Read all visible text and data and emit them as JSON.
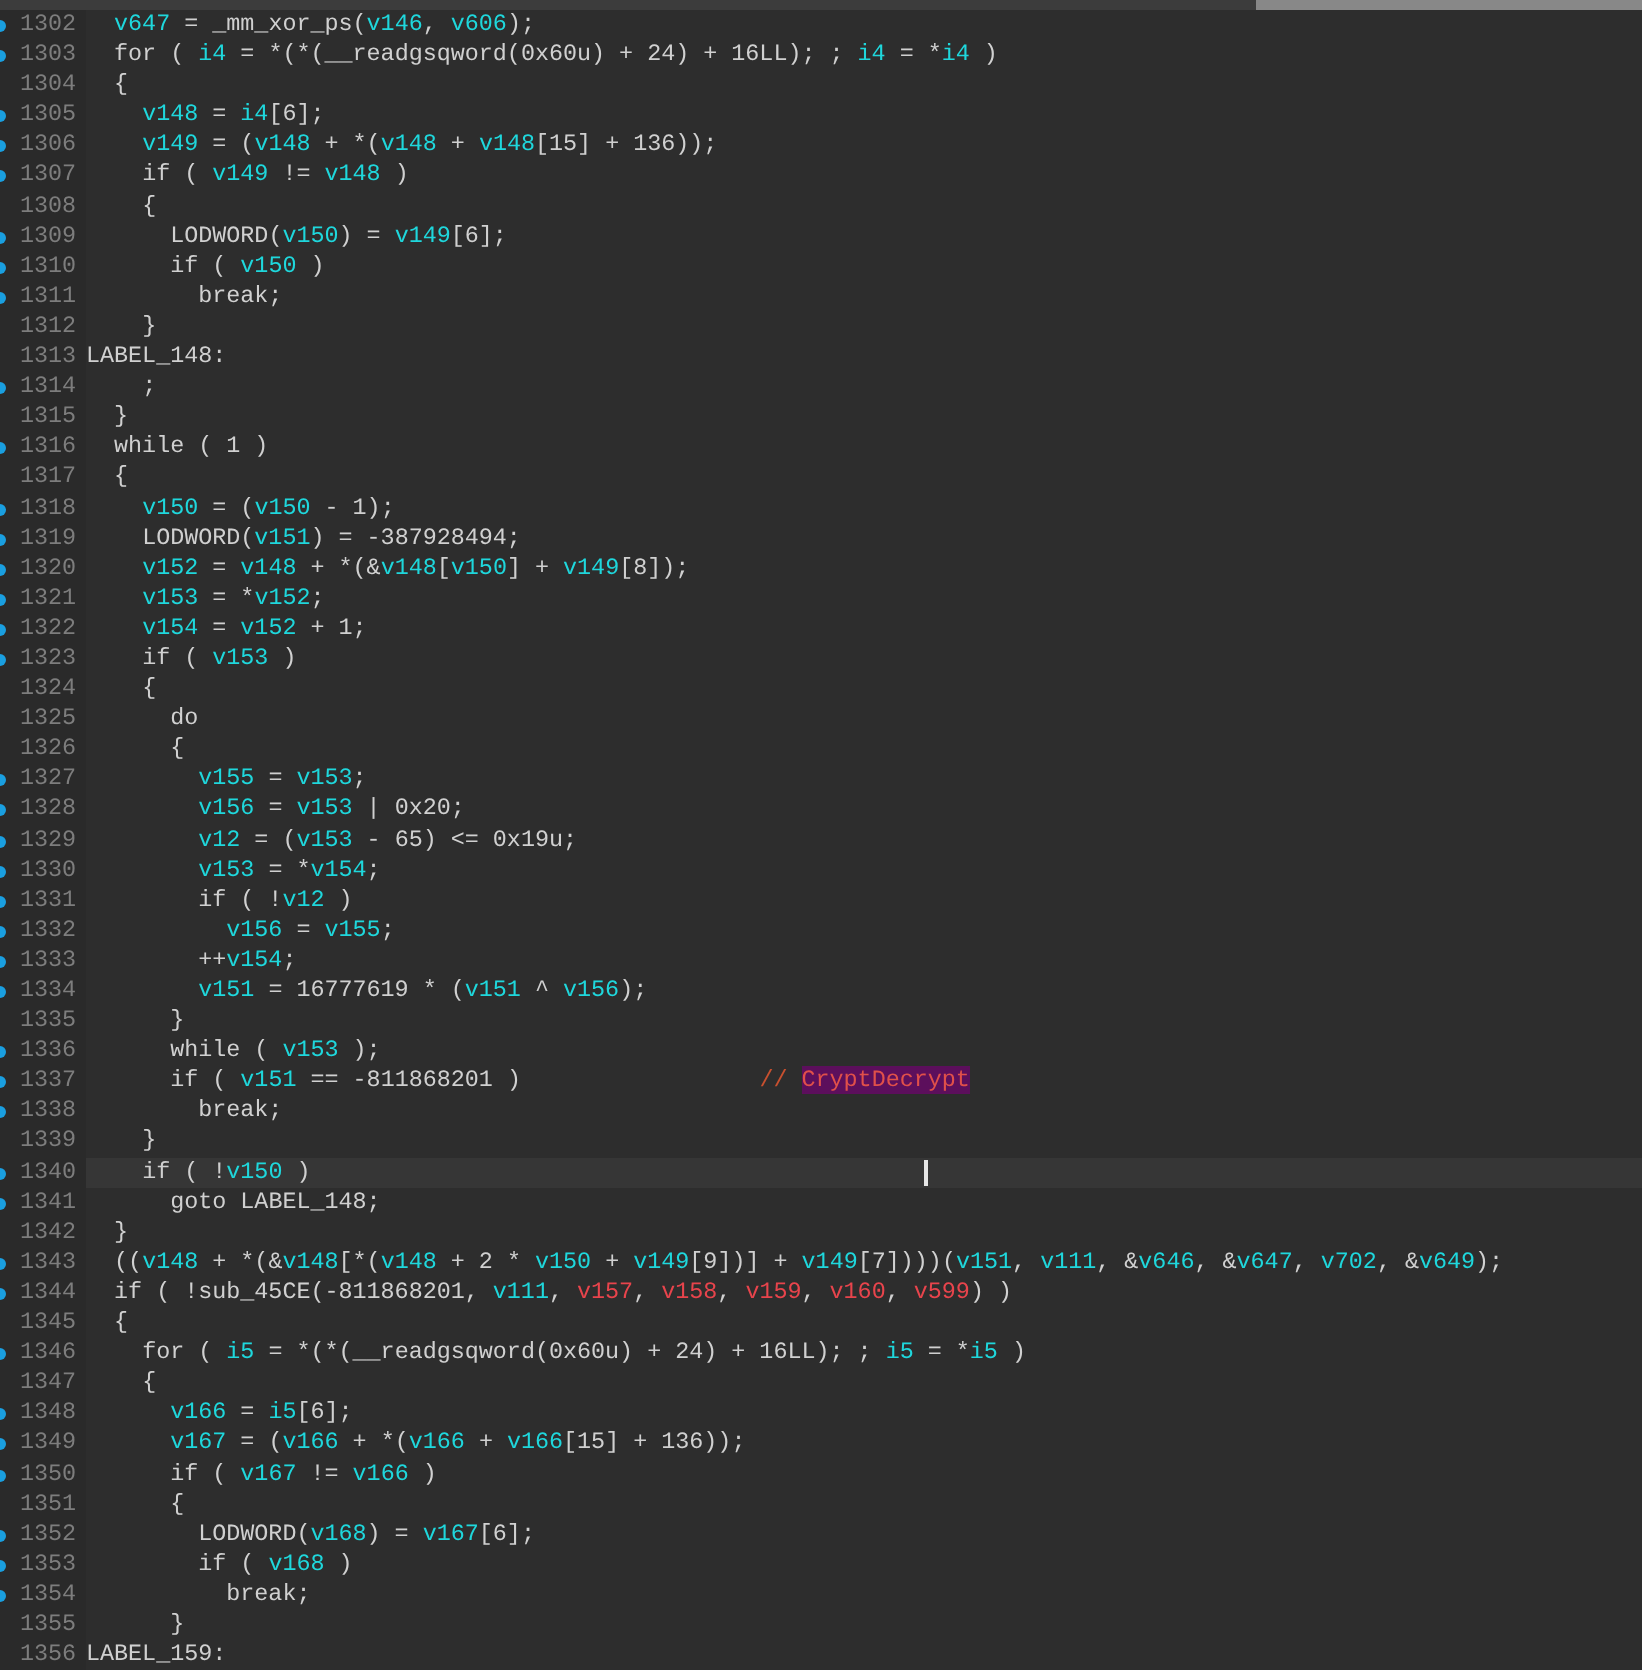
{
  "editor": {
    "lines": [
      {
        "number": "1302",
        "breakpoint": true,
        "selected": false,
        "code": [
          {
            "text": "  v647",
            "kind": "var"
          },
          {
            "text": " = _mm_xor_ps(",
            "kind": "plain"
          },
          {
            "text": "v146",
            "kind": "var"
          },
          {
            "text": ", ",
            "kind": "plain"
          },
          {
            "text": "v606",
            "kind": "var"
          },
          {
            "text": ");",
            "kind": "plain"
          }
        ]
      },
      {
        "number": "1303",
        "breakpoint": true,
        "selected": false,
        "code": [
          {
            "text": "  for ( ",
            "kind": "plain"
          },
          {
            "text": "i4",
            "kind": "var"
          },
          {
            "text": " = *(*(__readgsqword(0x60u) + 24) + 16LL); ; ",
            "kind": "plain"
          },
          {
            "text": "i4",
            "kind": "var"
          },
          {
            "text": " = *",
            "kind": "plain"
          },
          {
            "text": "i4",
            "kind": "var"
          },
          {
            "text": " )",
            "kind": "plain"
          }
        ]
      },
      {
        "number": "1304",
        "breakpoint": false,
        "selected": false,
        "code": [
          {
            "text": "  {",
            "kind": "plain"
          }
        ]
      },
      {
        "number": "1305",
        "breakpoint": true,
        "selected": false,
        "code": [
          {
            "text": "    v148",
            "kind": "var"
          },
          {
            "text": " = ",
            "kind": "plain"
          },
          {
            "text": "i4",
            "kind": "var"
          },
          {
            "text": "[6];",
            "kind": "plain"
          }
        ]
      },
      {
        "number": "1306",
        "breakpoint": true,
        "selected": false,
        "code": [
          {
            "text": "    v149",
            "kind": "var"
          },
          {
            "text": " = (",
            "kind": "plain"
          },
          {
            "text": "v148",
            "kind": "var"
          },
          {
            "text": " + *(",
            "kind": "plain"
          },
          {
            "text": "v148",
            "kind": "var"
          },
          {
            "text": " + ",
            "kind": "plain"
          },
          {
            "text": "v148",
            "kind": "var"
          },
          {
            "text": "[15] + 136));",
            "kind": "plain"
          }
        ]
      },
      {
        "number": "1307",
        "breakpoint": true,
        "selected": false,
        "code": [
          {
            "text": "    if ( ",
            "kind": "plain"
          },
          {
            "text": "v149",
            "kind": "var"
          },
          {
            "text": " != ",
            "kind": "plain"
          },
          {
            "text": "v148",
            "kind": "var"
          },
          {
            "text": " )",
            "kind": "plain"
          }
        ]
      },
      {
        "number": "1308",
        "breakpoint": false,
        "selected": false,
        "code": [
          {
            "text": "    {",
            "kind": "plain"
          }
        ]
      },
      {
        "number": "1309",
        "breakpoint": true,
        "selected": false,
        "code": [
          {
            "text": "      LODWORD(",
            "kind": "plain"
          },
          {
            "text": "v150",
            "kind": "var"
          },
          {
            "text": ") = ",
            "kind": "plain"
          },
          {
            "text": "v149",
            "kind": "var"
          },
          {
            "text": "[6];",
            "kind": "plain"
          }
        ]
      },
      {
        "number": "1310",
        "breakpoint": true,
        "selected": false,
        "code": [
          {
            "text": "      if ( ",
            "kind": "plain"
          },
          {
            "text": "v150",
            "kind": "var"
          },
          {
            "text": " )",
            "kind": "plain"
          }
        ]
      },
      {
        "number": "1311",
        "breakpoint": true,
        "selected": false,
        "code": [
          {
            "text": "        break;",
            "kind": "plain"
          }
        ]
      },
      {
        "number": "1312",
        "breakpoint": false,
        "selected": false,
        "code": [
          {
            "text": "    }",
            "kind": "plain"
          }
        ]
      },
      {
        "number": "1313",
        "breakpoint": false,
        "selected": false,
        "code": [
          {
            "text": "LABEL_148:",
            "kind": "plain"
          }
        ]
      },
      {
        "number": "1314",
        "breakpoint": true,
        "selected": false,
        "code": [
          {
            "text": "    ;",
            "kind": "plain"
          }
        ]
      },
      {
        "number": "1315",
        "breakpoint": false,
        "selected": false,
        "code": [
          {
            "text": "  }",
            "kind": "plain"
          }
        ]
      },
      {
        "number": "1316",
        "breakpoint": true,
        "selected": false,
        "code": [
          {
            "text": "  while ( 1 )",
            "kind": "plain"
          }
        ]
      },
      {
        "number": "1317",
        "breakpoint": false,
        "selected": false,
        "code": [
          {
            "text": "  {",
            "kind": "plain"
          }
        ]
      },
      {
        "number": "1318",
        "breakpoint": true,
        "selected": false,
        "code": [
          {
            "text": "    v150",
            "kind": "var"
          },
          {
            "text": " = (",
            "kind": "plain"
          },
          {
            "text": "v150",
            "kind": "var"
          },
          {
            "text": " - 1);",
            "kind": "plain"
          }
        ]
      },
      {
        "number": "1319",
        "breakpoint": true,
        "selected": false,
        "code": [
          {
            "text": "    LODWORD(",
            "kind": "plain"
          },
          {
            "text": "v151",
            "kind": "var"
          },
          {
            "text": ") = -387928494;",
            "kind": "plain"
          }
        ]
      },
      {
        "number": "1320",
        "breakpoint": true,
        "selected": false,
        "code": [
          {
            "text": "    v152",
            "kind": "var"
          },
          {
            "text": " = ",
            "kind": "plain"
          },
          {
            "text": "v148",
            "kind": "var"
          },
          {
            "text": " + *(&",
            "kind": "plain"
          },
          {
            "text": "v148",
            "kind": "var"
          },
          {
            "text": "[",
            "kind": "plain"
          },
          {
            "text": "v150",
            "kind": "var"
          },
          {
            "text": "] + ",
            "kind": "plain"
          },
          {
            "text": "v149",
            "kind": "var"
          },
          {
            "text": "[8]);",
            "kind": "plain"
          }
        ]
      },
      {
        "number": "1321",
        "breakpoint": true,
        "selected": false,
        "code": [
          {
            "text": "    v153",
            "kind": "var"
          },
          {
            "text": " = *",
            "kind": "plain"
          },
          {
            "text": "v152",
            "kind": "var"
          },
          {
            "text": ";",
            "kind": "plain"
          }
        ]
      },
      {
        "number": "1322",
        "breakpoint": true,
        "selected": false,
        "code": [
          {
            "text": "    v154",
            "kind": "var"
          },
          {
            "text": " = ",
            "kind": "plain"
          },
          {
            "text": "v152",
            "kind": "var"
          },
          {
            "text": " + 1;",
            "kind": "plain"
          }
        ]
      },
      {
        "number": "1323",
        "breakpoint": true,
        "selected": false,
        "code": [
          {
            "text": "    if ( ",
            "kind": "plain"
          },
          {
            "text": "v153",
            "kind": "var"
          },
          {
            "text": " )",
            "kind": "plain"
          }
        ]
      },
      {
        "number": "1324",
        "breakpoint": false,
        "selected": false,
        "code": [
          {
            "text": "    {",
            "kind": "plain"
          }
        ]
      },
      {
        "number": "1325",
        "breakpoint": false,
        "selected": false,
        "code": [
          {
            "text": "      do",
            "kind": "plain"
          }
        ]
      },
      {
        "number": "1326",
        "breakpoint": false,
        "selected": false,
        "code": [
          {
            "text": "      {",
            "kind": "plain"
          }
        ]
      },
      {
        "number": "1327",
        "breakpoint": true,
        "selected": false,
        "code": [
          {
            "text": "        v155",
            "kind": "var"
          },
          {
            "text": " = ",
            "kind": "plain"
          },
          {
            "text": "v153",
            "kind": "var"
          },
          {
            "text": ";",
            "kind": "plain"
          }
        ]
      },
      {
        "number": "1328",
        "breakpoint": true,
        "selected": false,
        "code": [
          {
            "text": "        v156",
            "kind": "var"
          },
          {
            "text": " = ",
            "kind": "plain"
          },
          {
            "text": "v153",
            "kind": "var"
          },
          {
            "text": " | 0x20;",
            "kind": "plain"
          }
        ]
      },
      {
        "number": "1329",
        "breakpoint": true,
        "selected": false,
        "code": [
          {
            "text": "        v12",
            "kind": "var"
          },
          {
            "text": " = (",
            "kind": "plain"
          },
          {
            "text": "v153",
            "kind": "var"
          },
          {
            "text": " - 65) <= 0x19u;",
            "kind": "plain"
          }
        ]
      },
      {
        "number": "1330",
        "breakpoint": true,
        "selected": false,
        "code": [
          {
            "text": "        v153",
            "kind": "var"
          },
          {
            "text": " = *",
            "kind": "plain"
          },
          {
            "text": "v154",
            "kind": "var"
          },
          {
            "text": ";",
            "kind": "plain"
          }
        ]
      },
      {
        "number": "1331",
        "breakpoint": true,
        "selected": false,
        "code": [
          {
            "text": "        if ( !",
            "kind": "plain"
          },
          {
            "text": "v12",
            "kind": "var"
          },
          {
            "text": " )",
            "kind": "plain"
          }
        ]
      },
      {
        "number": "1332",
        "breakpoint": true,
        "selected": false,
        "code": [
          {
            "text": "          v156",
            "kind": "var"
          },
          {
            "text": " = ",
            "kind": "plain"
          },
          {
            "text": "v155",
            "kind": "var"
          },
          {
            "text": ";",
            "kind": "plain"
          }
        ]
      },
      {
        "number": "1333",
        "breakpoint": true,
        "selected": false,
        "code": [
          {
            "text": "        ++",
            "kind": "plain"
          },
          {
            "text": "v154",
            "kind": "var"
          },
          {
            "text": ";",
            "kind": "plain"
          }
        ]
      },
      {
        "number": "1334",
        "breakpoint": true,
        "selected": false,
        "code": [
          {
            "text": "        v151",
            "kind": "var"
          },
          {
            "text": " = 16777619 * (",
            "kind": "plain"
          },
          {
            "text": "v151",
            "kind": "var"
          },
          {
            "text": " ^ ",
            "kind": "plain"
          },
          {
            "text": "v156",
            "kind": "var"
          },
          {
            "text": ");",
            "kind": "plain"
          }
        ]
      },
      {
        "number": "1335",
        "breakpoint": false,
        "selected": false,
        "code": [
          {
            "text": "      }",
            "kind": "plain"
          }
        ]
      },
      {
        "number": "1336",
        "breakpoint": true,
        "selected": false,
        "code": [
          {
            "text": "      while ( ",
            "kind": "plain"
          },
          {
            "text": "v153",
            "kind": "var"
          },
          {
            "text": " );",
            "kind": "plain"
          }
        ]
      },
      {
        "number": "1337",
        "breakpoint": true,
        "selected": false,
        "code": [
          {
            "text": "      if ( ",
            "kind": "plain"
          },
          {
            "text": "v151",
            "kind": "var"
          },
          {
            "text": " == -811868201 )                 ",
            "kind": "plain"
          },
          {
            "text": "// ",
            "kind": "comment"
          },
          {
            "text": "CryptDecrypt",
            "kind": "highlight"
          }
        ]
      },
      {
        "number": "1338",
        "breakpoint": true,
        "selected": false,
        "code": [
          {
            "text": "        break;",
            "kind": "plain"
          }
        ]
      },
      {
        "number": "1339",
        "breakpoint": false,
        "selected": false,
        "code": [
          {
            "text": "    }",
            "kind": "plain"
          }
        ]
      },
      {
        "number": "1340",
        "breakpoint": true,
        "selected": true,
        "code": [
          {
            "text": "    if ( !",
            "kind": "plain"
          },
          {
            "text": "v150",
            "kind": "var"
          },
          {
            "text": " )",
            "kind": "plain"
          }
        ]
      },
      {
        "number": "1341",
        "breakpoint": true,
        "selected": false,
        "code": [
          {
            "text": "      goto LABEL_148;",
            "kind": "plain"
          }
        ]
      },
      {
        "number": "1342",
        "breakpoint": false,
        "selected": false,
        "code": [
          {
            "text": "  }",
            "kind": "plain"
          }
        ]
      },
      {
        "number": "1343",
        "breakpoint": true,
        "selected": false,
        "code": [
          {
            "text": "  ((",
            "kind": "plain"
          },
          {
            "text": "v148",
            "kind": "var"
          },
          {
            "text": " + *(&",
            "kind": "plain"
          },
          {
            "text": "v148",
            "kind": "var"
          },
          {
            "text": "[*(",
            "kind": "plain"
          },
          {
            "text": "v148",
            "kind": "var"
          },
          {
            "text": " + 2 * ",
            "kind": "plain"
          },
          {
            "text": "v150",
            "kind": "var"
          },
          {
            "text": " + ",
            "kind": "plain"
          },
          {
            "text": "v149",
            "kind": "var"
          },
          {
            "text": "[9])] + ",
            "kind": "plain"
          },
          {
            "text": "v149",
            "kind": "var"
          },
          {
            "text": "[7])))(",
            "kind": "plain"
          },
          {
            "text": "v151",
            "kind": "var"
          },
          {
            "text": ", ",
            "kind": "plain"
          },
          {
            "text": "v111",
            "kind": "var"
          },
          {
            "text": ", &",
            "kind": "plain"
          },
          {
            "text": "v646",
            "kind": "var"
          },
          {
            "text": ", &",
            "kind": "plain"
          },
          {
            "text": "v647",
            "kind": "var"
          },
          {
            "text": ", ",
            "kind": "plain"
          },
          {
            "text": "v702",
            "kind": "var"
          },
          {
            "text": ", &",
            "kind": "plain"
          },
          {
            "text": "v649",
            "kind": "var"
          },
          {
            "text": ");",
            "kind": "plain"
          }
        ]
      },
      {
        "number": "1344",
        "breakpoint": true,
        "selected": false,
        "code": [
          {
            "text": "  if ( !sub_45CE(-811868201, ",
            "kind": "plain"
          },
          {
            "text": "v111",
            "kind": "var"
          },
          {
            "text": ", ",
            "kind": "plain"
          },
          {
            "text": "v157",
            "kind": "arg"
          },
          {
            "text": ", ",
            "kind": "plain"
          },
          {
            "text": "v158",
            "kind": "arg"
          },
          {
            "text": ", ",
            "kind": "plain"
          },
          {
            "text": "v159",
            "kind": "arg"
          },
          {
            "text": ", ",
            "kind": "plain"
          },
          {
            "text": "v160",
            "kind": "arg"
          },
          {
            "text": ", ",
            "kind": "plain"
          },
          {
            "text": "v599",
            "kind": "arg"
          },
          {
            "text": ") )",
            "kind": "plain"
          }
        ]
      },
      {
        "number": "1345",
        "breakpoint": false,
        "selected": false,
        "code": [
          {
            "text": "  {",
            "kind": "plain"
          }
        ]
      },
      {
        "number": "1346",
        "breakpoint": true,
        "selected": false,
        "code": [
          {
            "text": "    for ( ",
            "kind": "plain"
          },
          {
            "text": "i5",
            "kind": "var"
          },
          {
            "text": " = *(*(__readgsqword(0x60u) + 24) + 16LL); ; ",
            "kind": "plain"
          },
          {
            "text": "i5",
            "kind": "var"
          },
          {
            "text": " = *",
            "kind": "plain"
          },
          {
            "text": "i5",
            "kind": "var"
          },
          {
            "text": " )",
            "kind": "plain"
          }
        ]
      },
      {
        "number": "1347",
        "breakpoint": false,
        "selected": false,
        "code": [
          {
            "text": "    {",
            "kind": "plain"
          }
        ]
      },
      {
        "number": "1348",
        "breakpoint": true,
        "selected": false,
        "code": [
          {
            "text": "      v166",
            "kind": "var"
          },
          {
            "text": " = ",
            "kind": "plain"
          },
          {
            "text": "i5",
            "kind": "var"
          },
          {
            "text": "[6];",
            "kind": "plain"
          }
        ]
      },
      {
        "number": "1349",
        "breakpoint": true,
        "selected": false,
        "code": [
          {
            "text": "      v167",
            "kind": "var"
          },
          {
            "text": " = (",
            "kind": "plain"
          },
          {
            "text": "v166",
            "kind": "var"
          },
          {
            "text": " + *(",
            "kind": "plain"
          },
          {
            "text": "v166",
            "kind": "var"
          },
          {
            "text": " + ",
            "kind": "plain"
          },
          {
            "text": "v166",
            "kind": "var"
          },
          {
            "text": "[15] + 136));",
            "kind": "plain"
          }
        ]
      },
      {
        "number": "1350",
        "breakpoint": true,
        "selected": false,
        "code": [
          {
            "text": "      if ( ",
            "kind": "plain"
          },
          {
            "text": "v167",
            "kind": "var"
          },
          {
            "text": " != ",
            "kind": "plain"
          },
          {
            "text": "v166",
            "kind": "var"
          },
          {
            "text": " )",
            "kind": "plain"
          }
        ]
      },
      {
        "number": "1351",
        "breakpoint": false,
        "selected": false,
        "code": [
          {
            "text": "      {",
            "kind": "plain"
          }
        ]
      },
      {
        "number": "1352",
        "breakpoint": true,
        "selected": false,
        "code": [
          {
            "text": "        LODWORD(",
            "kind": "plain"
          },
          {
            "text": "v168",
            "kind": "var"
          },
          {
            "text": ") = ",
            "kind": "plain"
          },
          {
            "text": "v167",
            "kind": "var"
          },
          {
            "text": "[6];",
            "kind": "plain"
          }
        ]
      },
      {
        "number": "1353",
        "breakpoint": true,
        "selected": false,
        "code": [
          {
            "text": "        if ( ",
            "kind": "plain"
          },
          {
            "text": "v168",
            "kind": "var"
          },
          {
            "text": " )",
            "kind": "plain"
          }
        ]
      },
      {
        "number": "1354",
        "breakpoint": true,
        "selected": false,
        "code": [
          {
            "text": "          break;",
            "kind": "plain"
          }
        ]
      },
      {
        "number": "1355",
        "breakpoint": false,
        "selected": false,
        "code": [
          {
            "text": "      }",
            "kind": "plain"
          }
        ]
      },
      {
        "number": "1356",
        "breakpoint": false,
        "selected": false,
        "code": [
          {
            "text": "LABEL_159:",
            "kind": "plain"
          }
        ]
      }
    ]
  }
}
